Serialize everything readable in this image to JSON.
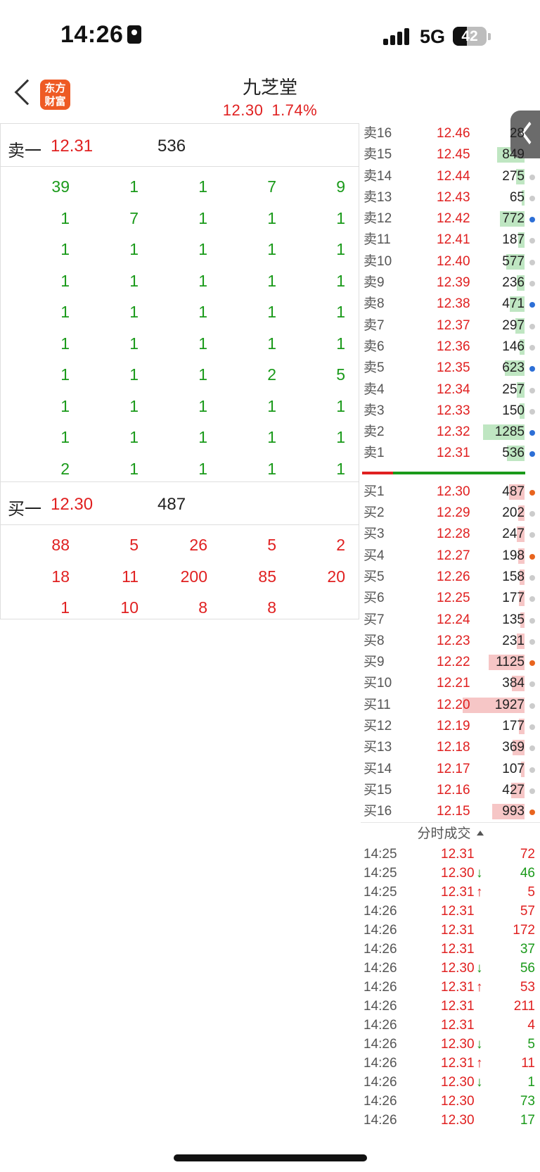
{
  "status": {
    "time": "14:26",
    "network": "5G",
    "battery": "42",
    "battery_level": 0.42
  },
  "header": {
    "title": "九芝堂",
    "price": "12.30",
    "change_pct": "1.74%",
    "logo_text_1": "东方",
    "logo_text_2": "财富"
  },
  "colors": {
    "red": "#e02020",
    "green": "#1a9a1a",
    "ask_bar": "#bfe6c2",
    "bid_bar": "#f6c6c6",
    "dot_blue": "#2d6fd6",
    "dot_orange": "#e8641e",
    "dot_gray": "#cccccc"
  },
  "sell_one": {
    "label": "卖一",
    "price": "12.31",
    "volume": "536"
  },
  "sell_grid": [
    [
      "39",
      "1",
      "1",
      "7",
      "9"
    ],
    [
      "1",
      "7",
      "1",
      "1",
      "1"
    ],
    [
      "1",
      "1",
      "1",
      "1",
      "1"
    ],
    [
      "1",
      "1",
      "1",
      "1",
      "1"
    ],
    [
      "1",
      "1",
      "1",
      "1",
      "1"
    ],
    [
      "1",
      "1",
      "1",
      "1",
      "1"
    ],
    [
      "1",
      "1",
      "1",
      "2",
      "5"
    ],
    [
      "1",
      "1",
      "1",
      "1",
      "1"
    ],
    [
      "1",
      "1",
      "1",
      "1",
      "1"
    ],
    [
      "2",
      "1",
      "1",
      "1",
      "1"
    ]
  ],
  "buy_one": {
    "label": "买一",
    "price": "12.30",
    "volume": "487"
  },
  "buy_grid": [
    [
      "88",
      "5",
      "26",
      "5",
      "2"
    ],
    [
      "18",
      "11",
      "200",
      "85",
      "20"
    ],
    [
      "1",
      "10",
      "8",
      "8",
      ""
    ]
  ],
  "asks": [
    {
      "label": "卖16",
      "price": "12.46",
      "vol": "28",
      "dot": "gray",
      "bar": 0.02
    },
    {
      "label": "卖15",
      "price": "12.45",
      "vol": "849",
      "dot": "gray",
      "bar": 0.44
    },
    {
      "label": "卖14",
      "price": "12.44",
      "vol": "275",
      "dot": "gray",
      "bar": 0.14
    },
    {
      "label": "卖13",
      "price": "12.43",
      "vol": "65",
      "dot": "gray",
      "bar": 0.04
    },
    {
      "label": "卖12",
      "price": "12.42",
      "vol": "772",
      "dot": "blue",
      "bar": 0.4
    },
    {
      "label": "卖11",
      "price": "12.41",
      "vol": "187",
      "dot": "gray",
      "bar": 0.1
    },
    {
      "label": "卖10",
      "price": "12.40",
      "vol": "577",
      "dot": "gray",
      "bar": 0.3
    },
    {
      "label": "卖9",
      "price": "12.39",
      "vol": "236",
      "dot": "gray",
      "bar": 0.12
    },
    {
      "label": "卖8",
      "price": "12.38",
      "vol": "471",
      "dot": "blue",
      "bar": 0.24
    },
    {
      "label": "卖7",
      "price": "12.37",
      "vol": "297",
      "dot": "gray",
      "bar": 0.15
    },
    {
      "label": "卖6",
      "price": "12.36",
      "vol": "146",
      "dot": "gray",
      "bar": 0.08
    },
    {
      "label": "卖5",
      "price": "12.35",
      "vol": "623",
      "dot": "blue",
      "bar": 0.32
    },
    {
      "label": "卖4",
      "price": "12.34",
      "vol": "257",
      "dot": "gray",
      "bar": 0.13
    },
    {
      "label": "卖3",
      "price": "12.33",
      "vol": "150",
      "dot": "gray",
      "bar": 0.08
    },
    {
      "label": "卖2",
      "price": "12.32",
      "vol": "1285",
      "dot": "blue",
      "bar": 0.67
    },
    {
      "label": "卖1",
      "price": "12.31",
      "vol": "536",
      "dot": "blue",
      "bar": 0.28
    }
  ],
  "bids": [
    {
      "label": "买1",
      "price": "12.30",
      "vol": "487",
      "dot": "orange",
      "bar": 0.25
    },
    {
      "label": "买2",
      "price": "12.29",
      "vol": "202",
      "dot": "gray",
      "bar": 0.1
    },
    {
      "label": "买3",
      "price": "12.28",
      "vol": "247",
      "dot": "gray",
      "bar": 0.13
    },
    {
      "label": "买4",
      "price": "12.27",
      "vol": "198",
      "dot": "orange",
      "bar": 0.1
    },
    {
      "label": "买5",
      "price": "12.26",
      "vol": "158",
      "dot": "gray",
      "bar": 0.08
    },
    {
      "label": "买6",
      "price": "12.25",
      "vol": "177",
      "dot": "gray",
      "bar": 0.09
    },
    {
      "label": "买7",
      "price": "12.24",
      "vol": "135",
      "dot": "gray",
      "bar": 0.07
    },
    {
      "label": "买8",
      "price": "12.23",
      "vol": "231",
      "dot": "gray",
      "bar": 0.12
    },
    {
      "label": "买9",
      "price": "12.22",
      "vol": "1125",
      "dot": "orange",
      "bar": 0.58
    },
    {
      "label": "买10",
      "price": "12.21",
      "vol": "384",
      "dot": "gray",
      "bar": 0.2
    },
    {
      "label": "买11",
      "price": "12.20",
      "vol": "1927",
      "dot": "gray",
      "bar": 1.0
    },
    {
      "label": "买12",
      "price": "12.19",
      "vol": "177",
      "dot": "gray",
      "bar": 0.09
    },
    {
      "label": "买13",
      "price": "12.18",
      "vol": "369",
      "dot": "gray",
      "bar": 0.19
    },
    {
      "label": "买14",
      "price": "12.17",
      "vol": "107",
      "dot": "gray",
      "bar": 0.06
    },
    {
      "label": "买15",
      "price": "12.16",
      "vol": "427",
      "dot": "gray",
      "bar": 0.22
    },
    {
      "label": "买16",
      "price": "12.15",
      "vol": "993",
      "dot": "orange",
      "bar": 0.52
    }
  ],
  "trades_title": "分时成交",
  "trades": [
    {
      "time": "14:25",
      "price": "12.31",
      "arrow": "",
      "vol": "72",
      "dir": "red"
    },
    {
      "time": "14:25",
      "price": "12.30",
      "arrow": "↓",
      "vol": "46",
      "dir": "green"
    },
    {
      "time": "14:25",
      "price": "12.31",
      "arrow": "↑",
      "vol": "5",
      "dir": "red"
    },
    {
      "time": "14:26",
      "price": "12.31",
      "arrow": "",
      "vol": "57",
      "dir": "red"
    },
    {
      "time": "14:26",
      "price": "12.31",
      "arrow": "",
      "vol": "172",
      "dir": "red"
    },
    {
      "time": "14:26",
      "price": "12.31",
      "arrow": "",
      "vol": "37",
      "dir": "green"
    },
    {
      "time": "14:26",
      "price": "12.30",
      "arrow": "↓",
      "vol": "56",
      "dir": "green"
    },
    {
      "time": "14:26",
      "price": "12.31",
      "arrow": "↑",
      "vol": "53",
      "dir": "red"
    },
    {
      "time": "14:26",
      "price": "12.31",
      "arrow": "",
      "vol": "211",
      "dir": "red"
    },
    {
      "time": "14:26",
      "price": "12.31",
      "arrow": "",
      "vol": "4",
      "dir": "red"
    },
    {
      "time": "14:26",
      "price": "12.30",
      "arrow": "↓",
      "vol": "5",
      "dir": "green"
    },
    {
      "time": "14:26",
      "price": "12.31",
      "arrow": "↑",
      "vol": "11",
      "dir": "red"
    },
    {
      "time": "14:26",
      "price": "12.30",
      "arrow": "↓",
      "vol": "1",
      "dir": "green"
    },
    {
      "time": "14:26",
      "price": "12.30",
      "arrow": "",
      "vol": "73",
      "dir": "green"
    },
    {
      "time": "14:26",
      "price": "12.30",
      "arrow": "",
      "vol": "17",
      "dir": "green"
    }
  ],
  "ratio": {
    "sell": 0.19,
    "buy": 0.81
  }
}
